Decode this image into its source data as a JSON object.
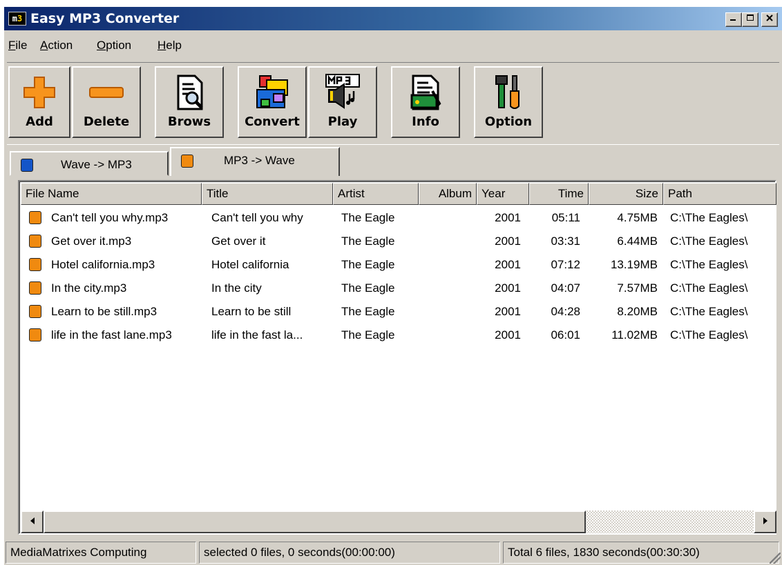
{
  "window": {
    "title": "Easy MP3 Converter",
    "icon_text": "m3",
    "controls": [
      "minimize",
      "maximize",
      "close"
    ]
  },
  "menu": [
    {
      "key": "F",
      "rest": "ile"
    },
    {
      "key": "A",
      "rest": "ction"
    },
    {
      "key": "O",
      "rest": "ption"
    },
    {
      "key": "H",
      "rest": "elp"
    }
  ],
  "toolbar": {
    "add": "Add",
    "delete": "Delete",
    "brows": "Brows",
    "convert": "Convert",
    "play": "Play",
    "info": "Info",
    "option": "Option"
  },
  "tabs": [
    {
      "label": "Wave -> MP3"
    },
    {
      "label": "MP3 -> Wave",
      "active": true
    }
  ],
  "table": {
    "columns": [
      "File Name",
      "Title",
      "Artist",
      "Album",
      "Year",
      "Time",
      "Size",
      "Path"
    ],
    "rows": [
      {
        "file": "Can't tell you why.mp3",
        "title": "Can't tell you why",
        "artist": "The Eagle",
        "album": "",
        "year": "2001",
        "time": "05:11",
        "size": "4.75MB",
        "path": "C:\\The Eagles\\"
      },
      {
        "file": "Get over it.mp3",
        "title": "Get over it",
        "artist": "The Eagle",
        "album": "",
        "year": "2001",
        "time": "03:31",
        "size": "6.44MB",
        "path": "C:\\The Eagles\\"
      },
      {
        "file": "Hotel california.mp3",
        "title": "Hotel california",
        "artist": "The Eagle",
        "album": "",
        "year": "2001",
        "time": "07:12",
        "size": "13.19MB",
        "path": "C:\\The Eagles\\"
      },
      {
        "file": "In the city.mp3",
        "title": "In the city",
        "artist": "The Eagle",
        "album": "",
        "year": "2001",
        "time": "04:07",
        "size": "7.57MB",
        "path": "C:\\The Eagles\\"
      },
      {
        "file": "Learn to be still.mp3",
        "title": "Learn to be still",
        "artist": "The Eagle",
        "album": "",
        "year": "2001",
        "time": "04:28",
        "size": "8.20MB",
        "path": "C:\\The Eagles\\"
      },
      {
        "file": "life in the fast lane.mp3",
        "title": "life in the fast la...",
        "artist": "The Eagle",
        "album": "",
        "year": "2001",
        "time": "06:01",
        "size": "11.02MB",
        "path": "C:\\The Eagles\\"
      }
    ]
  },
  "status": {
    "company": "MediaMatrixes Computing",
    "selected": "selected 0 files, 0 seconds(00:00:00)",
    "total": "Total 6 files, 1830 seconds(00:30:30)"
  },
  "colors": {
    "title_bar_start": "#0a246a",
    "title_bar_end": "#a6caf0",
    "face": "#d4d0c8",
    "file_icon": "#f08a10",
    "wave_tab_icon": "#1455c8"
  }
}
